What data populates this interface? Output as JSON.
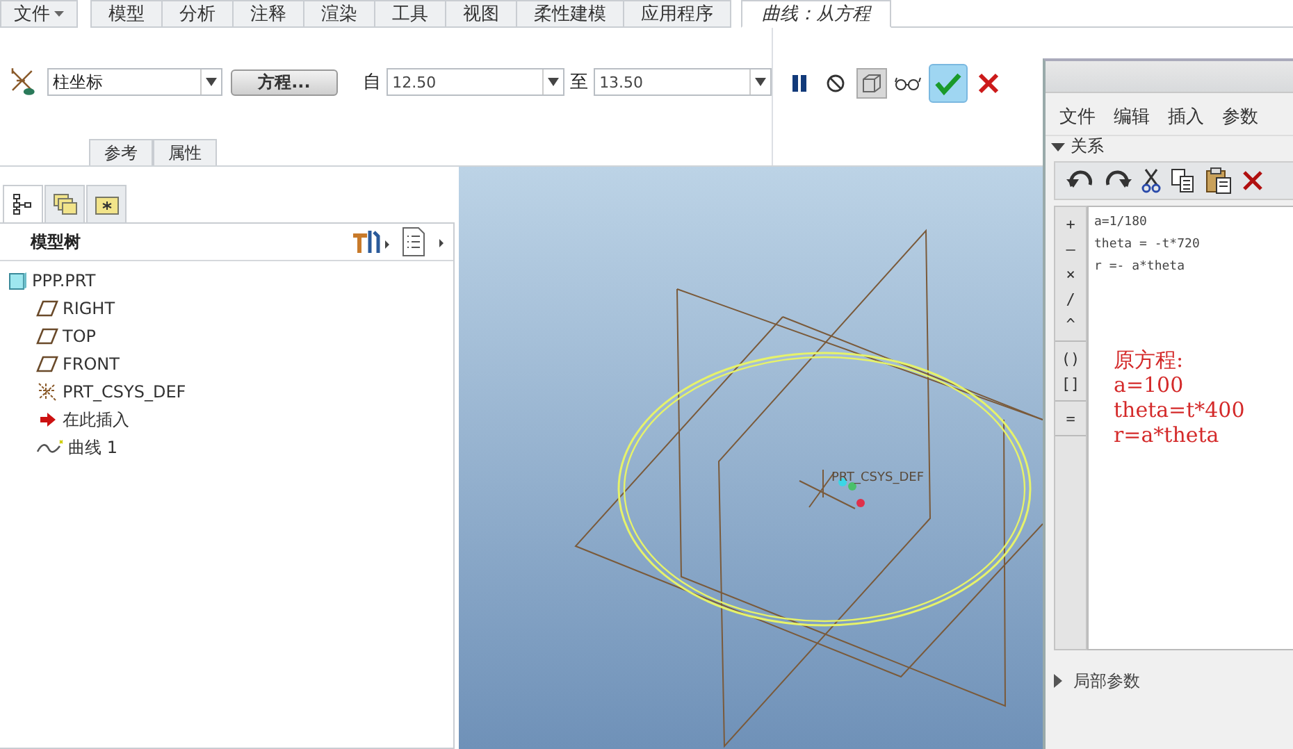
{
  "ribbon_tabs": [
    {
      "label": "文件",
      "kind": "menu",
      "selected": false
    },
    {
      "label": "模型",
      "kind": "tab",
      "selected": false
    },
    {
      "label": "分析",
      "kind": "tab",
      "selected": false
    },
    {
      "label": "注释",
      "kind": "tab",
      "selected": false
    },
    {
      "label": "渲染",
      "kind": "tab",
      "selected": false
    },
    {
      "label": "工具",
      "kind": "tab",
      "selected": false
    },
    {
      "label": "视图",
      "kind": "tab",
      "selected": false
    },
    {
      "label": "柔性建模",
      "kind": "tab",
      "selected": false
    },
    {
      "label": "应用程序",
      "kind": "tab",
      "selected": false
    },
    {
      "label": "曲线：从方程",
      "kind": "context",
      "selected": true
    }
  ],
  "dashboard": {
    "coordinate_system": "柱坐标",
    "equation_button": "方程...",
    "from_label": "自",
    "from_value": "12.50",
    "to_label": "至",
    "to_value": "13.50",
    "subtabs": [
      {
        "label": "参考",
        "selected": false
      },
      {
        "label": "属性",
        "selected": false
      }
    ],
    "tools": [
      {
        "kind": "pause",
        "on": false
      },
      {
        "kind": "cancel",
        "on": false
      },
      {
        "kind": "preview",
        "on": true
      },
      {
        "kind": "glasses",
        "on": false
      },
      {
        "kind": "ok",
        "on": true
      },
      {
        "kind": "close",
        "on": false
      }
    ]
  },
  "model_tree": {
    "tabs": [
      {
        "kind": "tree",
        "selected": true
      },
      {
        "kind": "folders",
        "selected": false
      },
      {
        "kind": "favorites",
        "selected": false
      }
    ],
    "title": "模型树",
    "items": [
      {
        "label": "PPP.PRT",
        "kind": "part",
        "children": [
          {
            "label": "RIGHT",
            "kind": "plane"
          },
          {
            "label": "TOP",
            "kind": "plane"
          },
          {
            "label": "FRONT",
            "kind": "plane"
          },
          {
            "label": "PRT_CSYS_DEF",
            "kind": "csys"
          },
          {
            "label": "在此插入",
            "kind": "insert"
          },
          {
            "label": "曲线 1",
            "kind": "curve"
          }
        ]
      }
    ]
  },
  "viewport": {
    "csys_label": "PRT_CSYS_DEF"
  },
  "relations_dialog": {
    "menu": [
      "文件",
      "编辑",
      "插入",
      "参数"
    ],
    "section": {
      "label": "关系",
      "expanded": true
    },
    "operators": [
      {
        "label": "+",
        "kind": "arithmetic"
      },
      {
        "label": "–",
        "kind": "arithmetic"
      },
      {
        "label": "×",
        "kind": "arithmetic"
      },
      {
        "label": "/",
        "kind": "arithmetic"
      },
      {
        "label": "^",
        "kind": "arithmetic"
      },
      {
        "label": "()",
        "kind": "bracket"
      },
      {
        "label": "[]",
        "kind": "bracket"
      },
      {
        "label": "=",
        "kind": "assign"
      }
    ],
    "relations": [
      "a=1/180",
      "theta = -t*720",
      "r =- a*theta"
    ],
    "note": [
      "原方程:",
      "a=100",
      "theta=t*400",
      "r=a*theta"
    ],
    "local_params": {
      "label": "局部参数",
      "expanded": false
    }
  }
}
